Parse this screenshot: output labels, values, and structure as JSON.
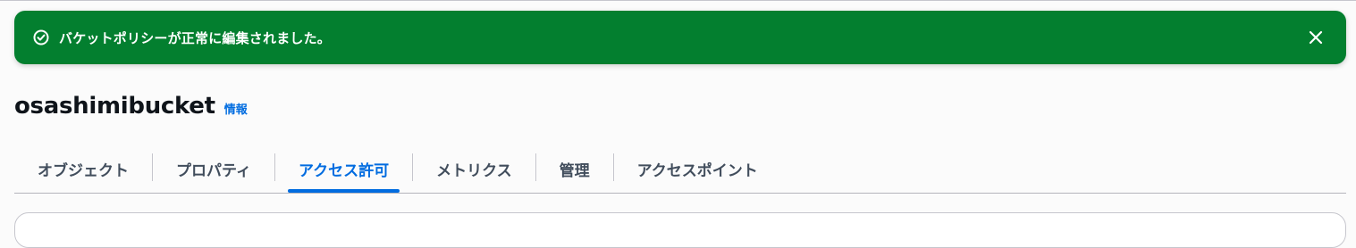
{
  "flash": {
    "message": "バケットポリシーが正常に編集されました。",
    "type": "success",
    "color": "#037f2f",
    "status_icon": "check-circle-icon",
    "dismiss_icon": "close-icon"
  },
  "header": {
    "title": "osashimibucket",
    "info_label": "情報"
  },
  "tabs": [
    {
      "label": "オブジェクト",
      "active": false
    },
    {
      "label": "プロパティ",
      "active": false
    },
    {
      "label": "アクセス許可",
      "active": true
    },
    {
      "label": "メトリクス",
      "active": false
    },
    {
      "label": "管理",
      "active": false
    },
    {
      "label": "アクセスポイント",
      "active": false
    }
  ],
  "accent_color": "#006ce0"
}
